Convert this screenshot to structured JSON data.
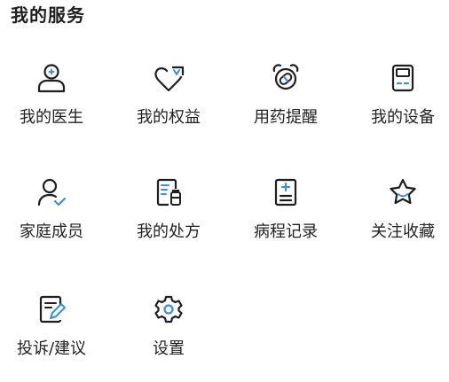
{
  "section_title": "我的服务",
  "colors": {
    "icon_stroke": "#1f1f1f",
    "accent": "#3a8ee6"
  },
  "services": [
    {
      "label": "我的医生",
      "icon": "doctor-icon"
    },
    {
      "label": "我的权益",
      "icon": "rights-shield-icon"
    },
    {
      "label": "用药提醒",
      "icon": "pill-alarm-icon"
    },
    {
      "label": "我的设备",
      "icon": "device-icon"
    },
    {
      "label": "家庭成员",
      "icon": "family-member-icon"
    },
    {
      "label": "我的处方",
      "icon": "prescription-icon"
    },
    {
      "label": "病程记录",
      "icon": "medical-record-icon"
    },
    {
      "label": "关注收藏",
      "icon": "favorite-star-icon"
    },
    {
      "label": "投诉/建议",
      "icon": "feedback-edit-icon"
    },
    {
      "label": "设置",
      "icon": "settings-gear-icon"
    }
  ]
}
